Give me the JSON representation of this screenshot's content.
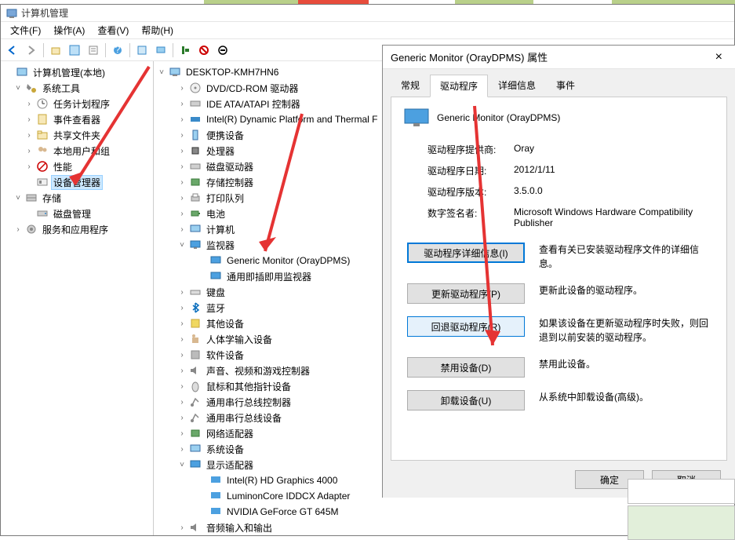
{
  "window": {
    "title": "计算机管理",
    "menus": [
      "文件(F)",
      "操作(A)",
      "查看(V)",
      "帮助(H)"
    ]
  },
  "left_tree": {
    "root": "计算机管理(本地)",
    "system_tools": "系统工具",
    "task_scheduler": "任务计划程序",
    "event_viewer": "事件查看器",
    "shared_folders": "共享文件夹",
    "local_users": "本地用户和组",
    "performance": "性能",
    "device_manager": "设备管理器",
    "storage": "存储",
    "disk_mgmt": "磁盘管理",
    "services_apps": "服务和应用程序"
  },
  "right_tree": {
    "root": "DESKTOP-KMH7HN6",
    "dvd": "DVD/CD-ROM 驱动器",
    "ide": "IDE ATA/ATAPI 控制器",
    "intel": "Intel(R) Dynamic Platform and Thermal F",
    "portable": "便携设备",
    "cpu": "处理器",
    "disk": "磁盘驱动器",
    "storage_ctrl": "存储控制器",
    "print_queue": "打印队列",
    "battery": "电池",
    "computer": "计算机",
    "monitors": "监视器",
    "mon1": "Generic Monitor (OrayDPMS)",
    "mon2": "通用即插即用监视器",
    "keyboard": "键盘",
    "bluetooth": "蓝牙",
    "other": "其他设备",
    "hid": "人体学输入设备",
    "software": "软件设备",
    "audio": "声音、视频和游戏控制器",
    "mouse": "鼠标和其他指针设备",
    "usb": "通用串行总线控制器",
    "usb_dev": "通用串行总线设备",
    "network": "网络适配器",
    "system_dev": "系统设备",
    "display": "显示适配器",
    "gpu1": "Intel(R) HD Graphics 4000",
    "gpu2": "LuminonCore IDDCX Adapter",
    "gpu3": "NVIDIA GeForce GT 645M",
    "audio_io": "音频输入和输出"
  },
  "dialog": {
    "title": "Generic Monitor (OrayDPMS) 属性",
    "tabs": [
      "常规",
      "驱动程序",
      "详细信息",
      "事件"
    ],
    "device_name": "Generic Monitor (OrayDPMS)",
    "provider_label": "驱动程序提供商:",
    "provider_value": "Oray",
    "date_label": "驱动程序日期:",
    "date_value": "2012/1/11",
    "version_label": "驱动程序版本:",
    "version_value": "3.5.0.0",
    "signer_label": "数字签名者:",
    "signer_value": "Microsoft Windows Hardware Compatibility Publisher",
    "btn_details": "驱动程序详细信息(I)",
    "btn_details_desc": "查看有关已安装驱动程序文件的详细信息。",
    "btn_update": "更新驱动程序(P)",
    "btn_update_desc": "更新此设备的驱动程序。",
    "btn_rollback": "回退驱动程序(R)",
    "btn_rollback_desc": "如果该设备在更新驱动程序时失败，则回退到以前安装的驱动程序。",
    "btn_disable": "禁用设备(D)",
    "btn_disable_desc": "禁用此设备。",
    "btn_uninstall": "卸载设备(U)",
    "btn_uninstall_desc": "从系统中卸载设备(高级)。",
    "ok": "确定",
    "cancel": "取消"
  }
}
